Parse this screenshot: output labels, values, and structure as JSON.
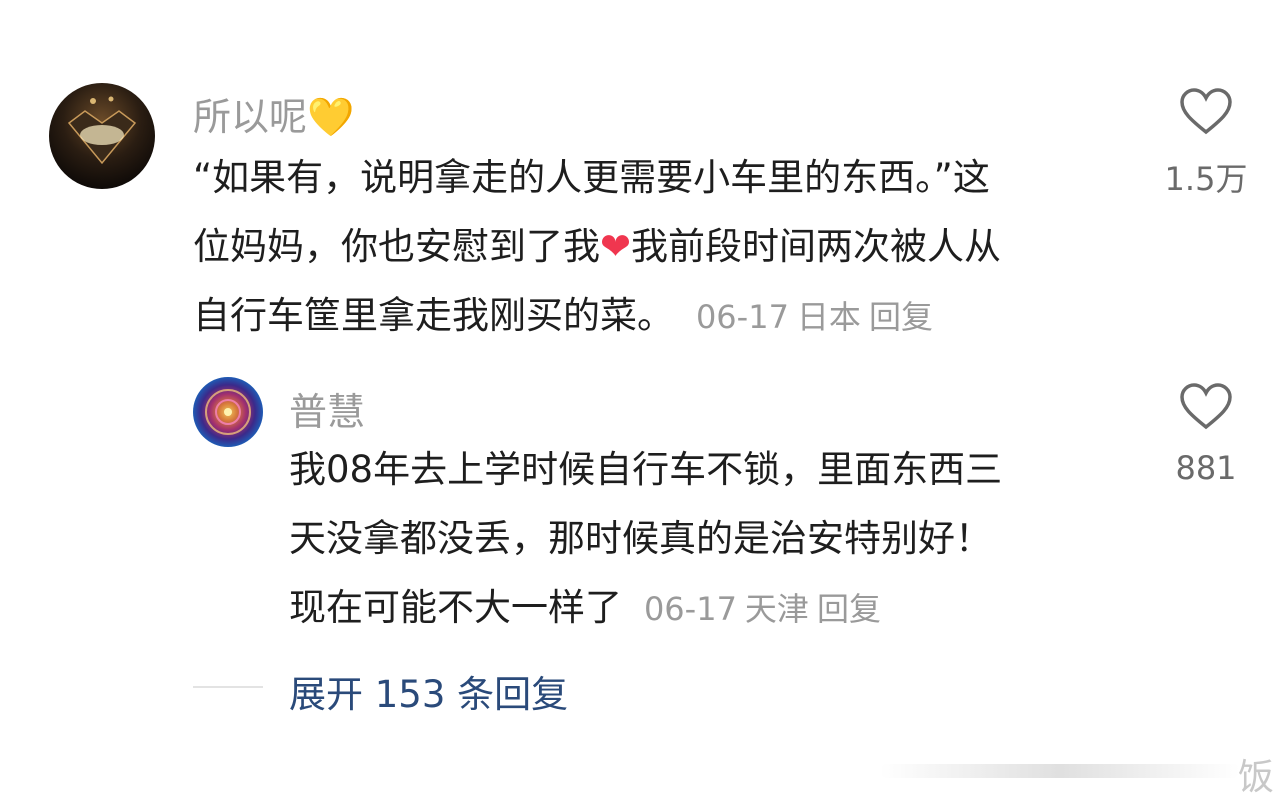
{
  "comment": {
    "username": "所以呢",
    "name_emoji": "💛",
    "text_lines": [
      "“如果有，说明拿走的人更需要小车里的东西。”这",
      "位妈妈，你也安慰到了我",
      "自行车筐里拿走我刚买的菜。"
    ],
    "line2_emoji": "❤",
    "line2_tail": "我前段时间两次被人从",
    "date": "06-17",
    "location": "日本",
    "reply_label": "回复",
    "like_count": "1.5万"
  },
  "reply": {
    "username": "普慧",
    "text_lines": [
      "我08年去上学时候自行车不锁，里面东西三",
      "天没拿都没丢，那时候真的是治安特别好！",
      "现在可能不大一样了"
    ],
    "date": "06-17",
    "location": "天津",
    "reply_label": "回复",
    "like_count": "881"
  },
  "expand_label": "展开 153 条回复",
  "watermark": "饭"
}
